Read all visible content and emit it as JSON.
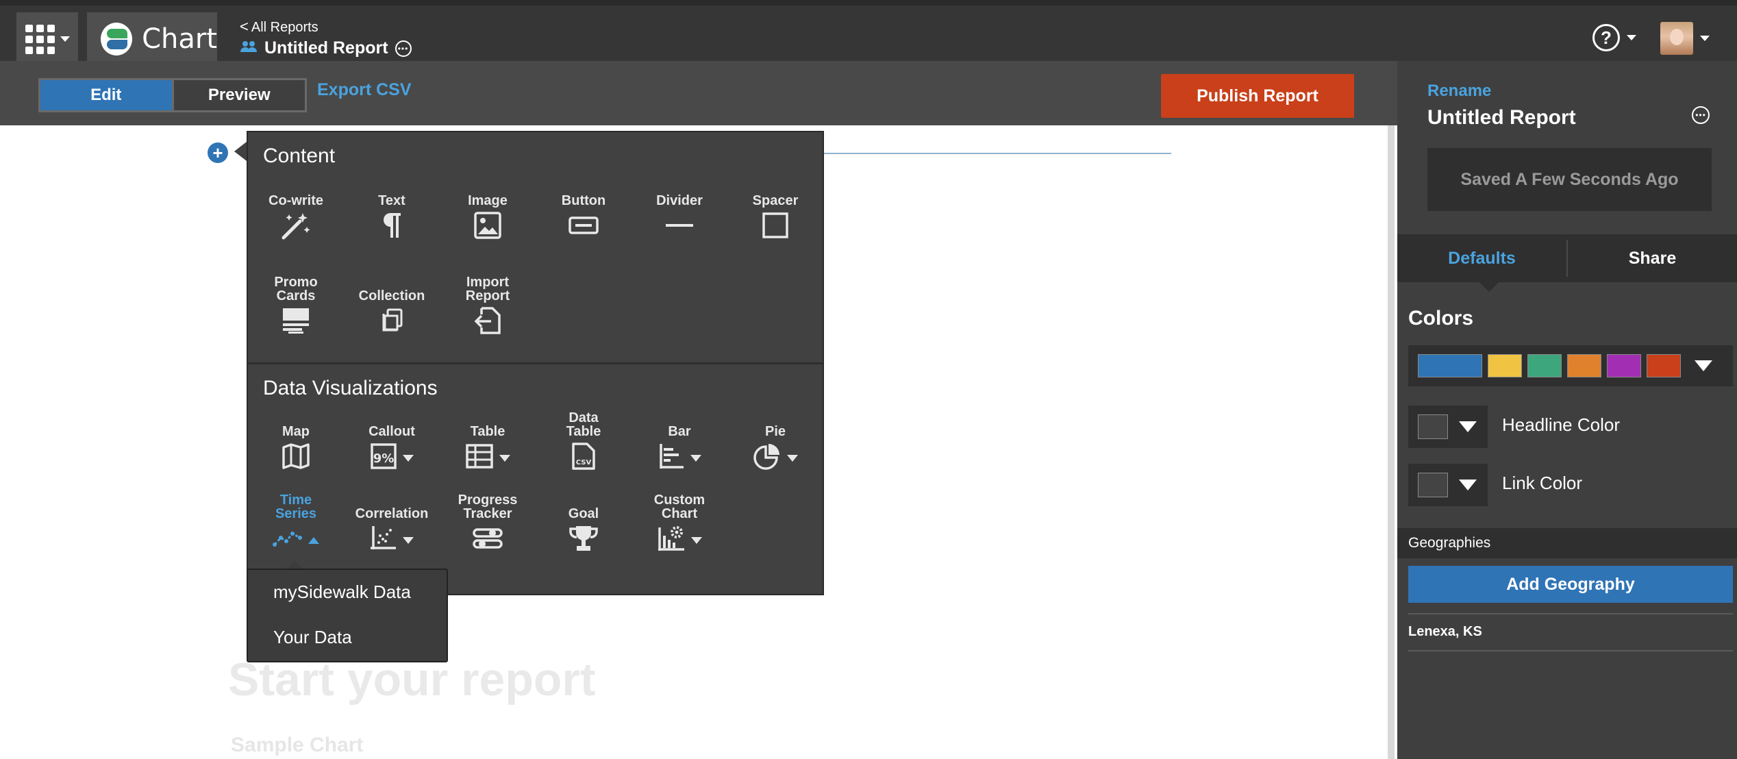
{
  "app": {
    "name": "Chart"
  },
  "header": {
    "breadcrumb": "All Reports",
    "breadcrumb_chevron": "<",
    "report_title": "Untitled Report",
    "help_glyph": "?"
  },
  "toolbar": {
    "edit_label": "Edit",
    "preview_label": "Preview",
    "export_label": "Export CSV",
    "publish_label": "Publish Report"
  },
  "content_menu": {
    "content_heading": "Content",
    "content_tools": [
      {
        "label": "Co-write",
        "icon": "magic-wand-icon"
      },
      {
        "label": "Text",
        "icon": "paragraph-icon"
      },
      {
        "label": "Image",
        "icon": "image-icon"
      },
      {
        "label": "Button",
        "icon": "button-icon"
      },
      {
        "label": "Divider",
        "icon": "divider-icon"
      },
      {
        "label": "Spacer",
        "icon": "spacer-icon"
      },
      {
        "label": "Promo\nCards",
        "icon": "promo-cards-icon"
      },
      {
        "label": "Collection",
        "icon": "collection-icon"
      },
      {
        "label": "Import\nReport",
        "icon": "import-report-icon"
      }
    ],
    "viz_heading": "Data Visualizations",
    "viz_tools": [
      {
        "label": "Map",
        "icon": "map-icon"
      },
      {
        "label": "Callout",
        "icon": "callout-icon",
        "icon_text": "9%"
      },
      {
        "label": "Table",
        "icon": "table-icon"
      },
      {
        "label": "Data\nTable",
        "icon": "csv-file-icon",
        "icon_text": "CSV"
      },
      {
        "label": "Bar",
        "icon": "bar-chart-icon"
      },
      {
        "label": "Pie",
        "icon": "pie-chart-icon"
      },
      {
        "label": "Time\nSeries",
        "icon": "time-series-icon",
        "active": true
      },
      {
        "label": "Correlation",
        "icon": "scatter-icon"
      },
      {
        "label": "Progress\nTracker",
        "icon": "progress-tracker-icon"
      },
      {
        "label": "Goal",
        "icon": "trophy-icon"
      },
      {
        "label": "Custom\nChart",
        "icon": "custom-chart-icon"
      }
    ],
    "time_series_submenu": [
      "mySidewalk Data",
      "Your Data"
    ]
  },
  "canvas": {
    "ghost_title": "Start your report",
    "ghost_subtitle": "Sample Chart"
  },
  "right_panel": {
    "rename_label": "Rename",
    "title": "Untitled Report",
    "saved_status": "Saved A Few Seconds Ago",
    "tabs": [
      "Defaults",
      "Share"
    ],
    "colors_heading": "Colors",
    "palette": [
      "#2f74b5",
      "#f0c442",
      "#3ea67c",
      "#e0822d",
      "#a22fb3",
      "#c9401a"
    ],
    "headline_color_label": "Headline Color",
    "link_color_label": "Link Color",
    "geographies_heading": "Geographies",
    "add_geography_label": "Add Geography",
    "geographies": [
      "Lenexa, KS"
    ]
  },
  "colors": {
    "accent": "#4aa3df",
    "primary": "#2f74b5",
    "publish": "#c9401a"
  }
}
